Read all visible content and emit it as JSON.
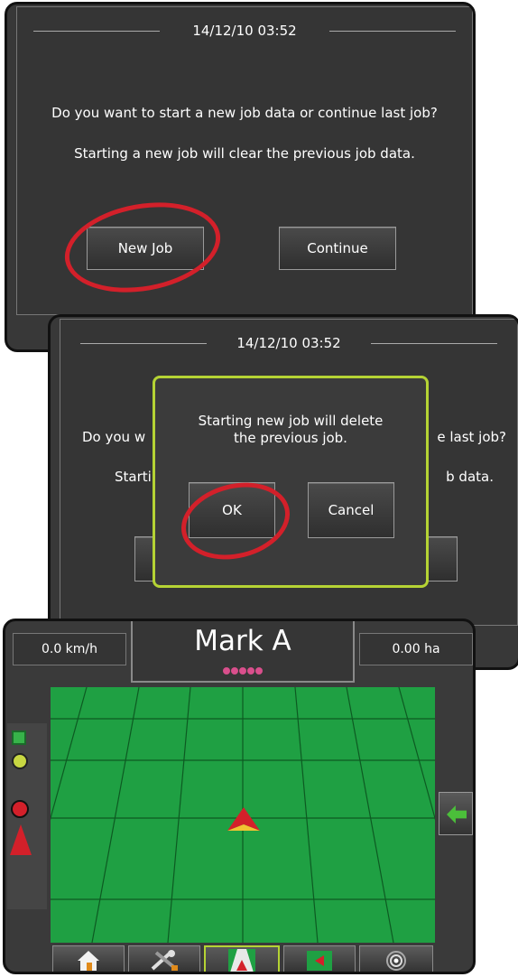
{
  "dialog1": {
    "datetime": "14/12/10 03:52",
    "question": "Do you want to start a new job data or continue last job?",
    "note": "Starting a new job will clear the previous job data.",
    "new_job_label": "New Job",
    "continue_label": "Continue"
  },
  "dialog2": {
    "datetime": "14/12/10 03:52",
    "question_left": "Do you w",
    "question_right": "e last job?",
    "note_left": "Starti",
    "note_right": "b data.",
    "confirm_message": "Starting new job will delete the previous job.",
    "ok_label": "OK",
    "cancel_label": "Cancel"
  },
  "guidance": {
    "speed": "0.0 km/h",
    "mode_title": "Mark A",
    "area": "0.00 ha",
    "nav_icons": [
      "home-icon",
      "tools-icon",
      "vehicle-view-icon",
      "field-map-icon",
      "gps-status-icon"
    ]
  },
  "colors": {
    "annotation_ring": "#d3202a",
    "dialog_border": "#b5d334",
    "field_green": "#1fa043",
    "vehicle_red": "#d3202a"
  }
}
